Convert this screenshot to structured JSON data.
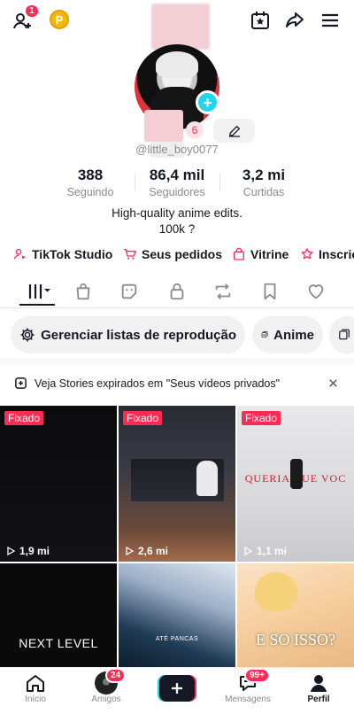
{
  "header": {
    "notif_count": "1",
    "coin_label": "P"
  },
  "profile": {
    "follow_requests": "6",
    "username": "@little_boy0077",
    "stats": [
      {
        "value": "388",
        "label": "Seguindo"
      },
      {
        "value": "86,4 mil",
        "label": "Seguidores"
      },
      {
        "value": "3,2 mi",
        "label": "Curtidas"
      }
    ],
    "bio_line1": "High-quality anime edits.",
    "bio_line2": "100k ?"
  },
  "links": [
    {
      "label": "TikTok Studio",
      "icon": "studio-icon"
    },
    {
      "label": "Seus pedidos",
      "icon": "cart-icon"
    },
    {
      "label": "Vitrine",
      "icon": "bag-icon"
    },
    {
      "label": "Inscriç",
      "icon": "subscribe-icon"
    }
  ],
  "tabs": [
    "videos",
    "shop",
    "favorites-sticker",
    "private",
    "reposts",
    "saved",
    "liked"
  ],
  "playlists": {
    "manage_label": "Gerenciar listas de reprodução",
    "anime_label": "Anime"
  },
  "notice": {
    "text": "Veja Stories expirados em \"Seus vídeos privados\""
  },
  "videos": [
    {
      "pinned": "Fixado",
      "views": "1,9 mi",
      "overlay": ""
    },
    {
      "pinned": "Fixado",
      "views": "2,6 mi",
      "overlay": ""
    },
    {
      "pinned": "Fixado",
      "views": "1,1 mi",
      "overlay": "QUERIA QUE VOC"
    },
    {
      "pinned": "",
      "views": "",
      "overlay": "NEXT LEVEL"
    },
    {
      "pinned": "",
      "views": "",
      "overlay": "ATÉ PANCAS"
    },
    {
      "pinned": "",
      "views": "",
      "overlay": "E SO ISSO?"
    }
  ],
  "nav": {
    "home": "Início",
    "friends": "Amigos",
    "friends_count": "24",
    "inbox": "Mensagens",
    "inbox_count": "99+",
    "profile": "Perfil"
  },
  "colors": {
    "accent": "#fe2c55",
    "cyan": "#20d5ec",
    "text": "#161823",
    "muted": "#8a8b91"
  }
}
